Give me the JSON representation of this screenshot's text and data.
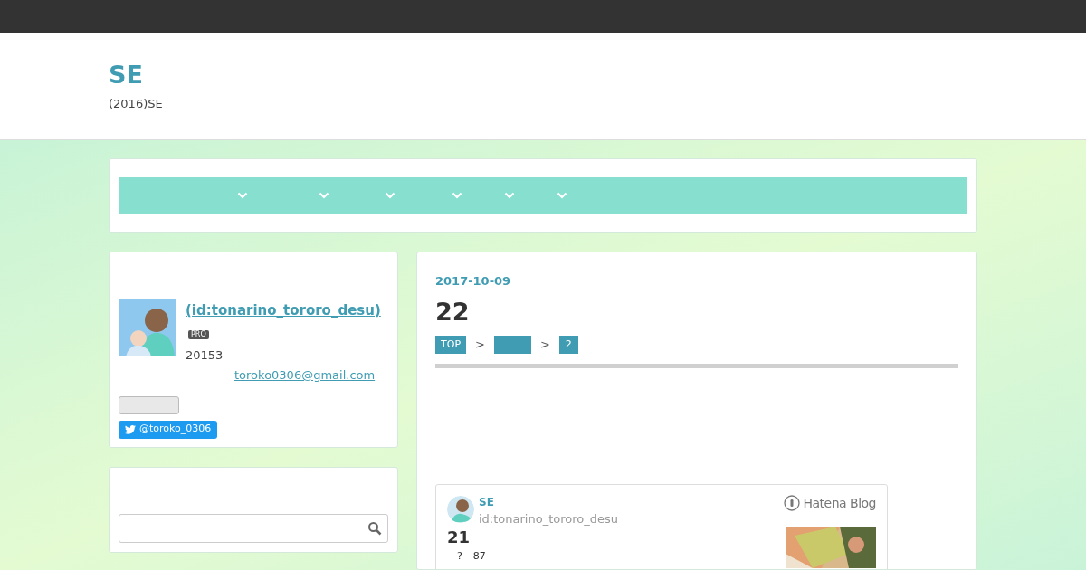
{
  "header": {
    "title": "SE",
    "subtitle": "(2016)SE"
  },
  "nav": {
    "items": [
      {
        "kind": "dropdown"
      },
      {
        "kind": "dropdown"
      },
      {
        "kind": "dropdown"
      },
      {
        "kind": "dropdown"
      },
      {
        "kind": "dropdown"
      },
      {
        "kind": "dropdown"
      }
    ]
  },
  "profile": {
    "name": " (id:tonarino_tororo_desu)",
    "badge": "PRO",
    "text": "20153",
    "email": "toroko0306@gmail.com",
    "twitter": "@toroko_0306"
  },
  "article": {
    "date": "2017-10-09",
    "title": "22",
    "breadcrumbs": [
      {
        "label": "TOP"
      },
      {
        "kind": "blank"
      },
      {
        "label": "2"
      }
    ],
    "separator": ">",
    "embed": {
      "blog": "SE",
      "user": "id:tonarino_tororo_desu",
      "title": "21",
      "meta_1": "?",
      "meta_2": "87",
      "service": "Hatena Blog"
    }
  }
}
